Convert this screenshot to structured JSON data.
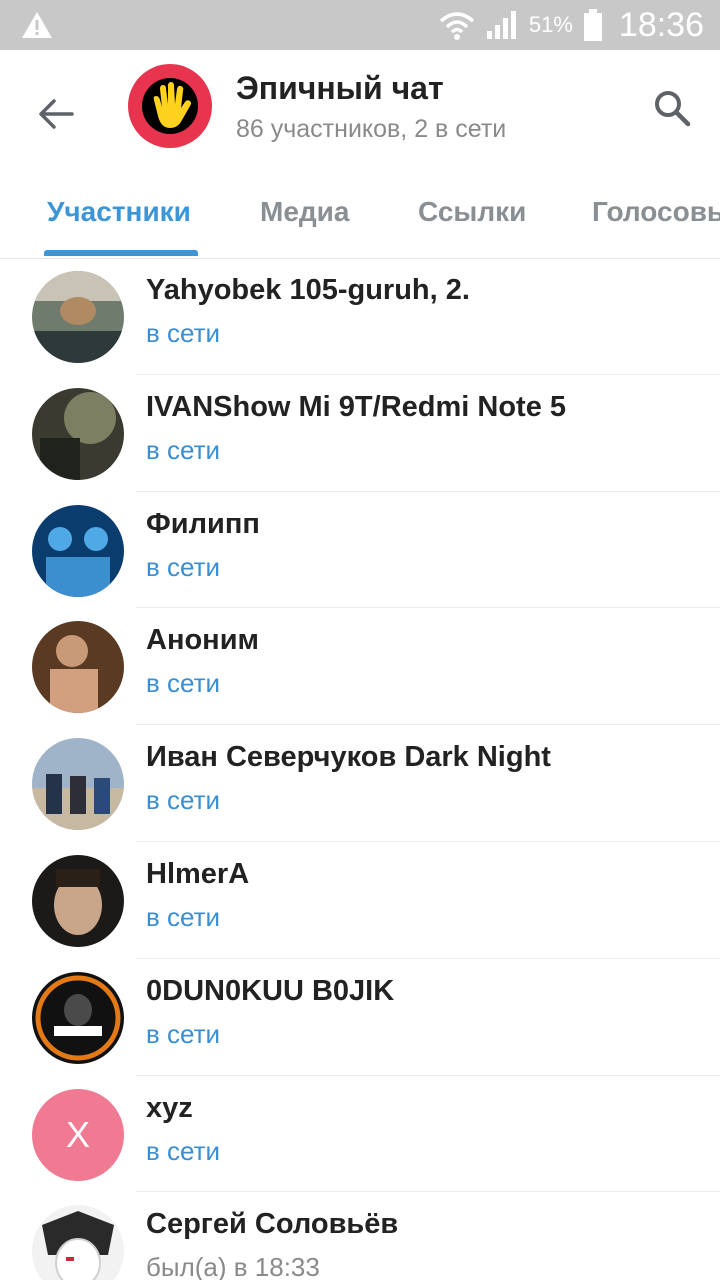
{
  "status_bar": {
    "battery_percent": "51%",
    "time": "18:36"
  },
  "chat": {
    "title": "Эпичный чат",
    "subtitle": "86 участников, 2 в сети",
    "avatar_color": "#e8344e"
  },
  "tabs": [
    {
      "label": "Участники",
      "active": true
    },
    {
      "label": "Медиа",
      "active": false
    },
    {
      "label": "Ссылки",
      "active": false
    },
    {
      "label": "Голосовые",
      "active": false
    }
  ],
  "accent_color": "#3b95d6",
  "members": [
    {
      "name": "Yahyobek 105-guruh, 2.",
      "status": "в сети",
      "online": true
    },
    {
      "name": "IVANShow Mi 9T/Redmi Note 5",
      "status": "в сети",
      "online": true
    },
    {
      "name": "Филипп",
      "status": "в сети",
      "online": true
    },
    {
      "name": "Аноним",
      "status": "в сети",
      "online": true
    },
    {
      "name": "Иван Северчуков Dark Night",
      "status": "в сети",
      "online": true
    },
    {
      "name": "HlmerA",
      "status": "в сети",
      "online": true
    },
    {
      "name": "0DUN0KUU B0JIK",
      "status": "в сети",
      "online": true
    },
    {
      "name": "xyz",
      "status": "в сети",
      "online": true,
      "avatar_letter": "X",
      "avatar_color": "#f07a92"
    },
    {
      "name": "Сергей Соловьёв",
      "status": "был(а) в 18:33",
      "online": false
    }
  ]
}
